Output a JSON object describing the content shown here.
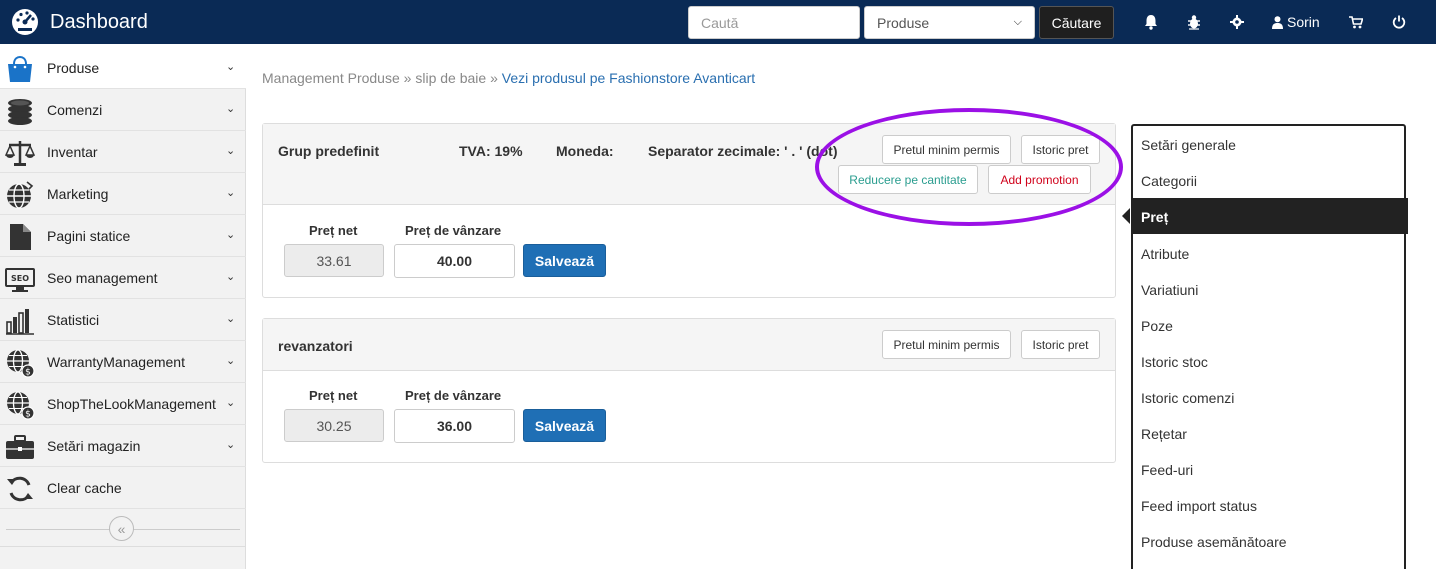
{
  "header": {
    "brand": "Dashboard",
    "search_placeholder": "Caută",
    "search_scope": "Produse",
    "search_button": "Căutare",
    "user_name": "Sorin"
  },
  "sidebar": {
    "items": [
      {
        "label": "Produse",
        "icon": "shopping-bag-icon"
      },
      {
        "label": "Comenzi",
        "icon": "coins-icon"
      },
      {
        "label": "Inventar",
        "icon": "scale-icon"
      },
      {
        "label": "Marketing",
        "icon": "globe-icon"
      },
      {
        "label": "Pagini statice",
        "icon": "file-icon"
      },
      {
        "label": "Seo management",
        "icon": "seo-monitor-icon"
      },
      {
        "label": "Statistici",
        "icon": "bar-chart-icon"
      },
      {
        "label": "WarrantyManagement",
        "icon": "globe-dollar-icon"
      },
      {
        "label": "ShopTheLookManagement",
        "icon": "globe-dollar-icon"
      },
      {
        "label": "Setări magazin",
        "icon": "briefcase-icon"
      },
      {
        "label": "Clear cache",
        "icon": "refresh-icon"
      }
    ]
  },
  "breadcrumb": {
    "part1": "Management Produse",
    "sep": "»",
    "part2": "slip de baie",
    "link": "Vezi produsul pe Fashionstore Avanticart"
  },
  "group1": {
    "title": "Grup predefinit",
    "tva": "TVA: 19%",
    "moneda": "Moneda:",
    "separator": "Separator zecimale: ' . ' (dot)",
    "btn_min_price": "Pretul minim permis",
    "btn_history": "Istoric pret",
    "btn_discount": "Reducere pe cantitate",
    "btn_promotion": "Add promotion",
    "label_net": "Preț net",
    "label_sale": "Preț de vânzare",
    "net": "33.61",
    "sale": "40.00",
    "save": "Salvează"
  },
  "group2": {
    "title": "revanzatori",
    "btn_min_price": "Pretul minim permis",
    "btn_history": "Istoric pret",
    "label_net": "Preț net",
    "label_sale": "Preț de vânzare",
    "net": "30.25",
    "sale": "36.00",
    "save": "Salvează"
  },
  "right_nav": {
    "items": [
      {
        "label": "Setări generale"
      },
      {
        "label": "Categorii"
      },
      {
        "label": "Preț"
      },
      {
        "label": "Atribute"
      },
      {
        "label": "Variatiuni"
      },
      {
        "label": "Poze"
      },
      {
        "label": "Istoric stoc"
      },
      {
        "label": "Istoric comenzi"
      },
      {
        "label": "Rețetar"
      },
      {
        "label": "Feed-uri"
      },
      {
        "label": "Feed import status"
      },
      {
        "label": "Produse asemănătoare"
      }
    ]
  },
  "colors": {
    "topbar": "#0a2a55",
    "primary_button": "#1f6fb5",
    "annotation": "#9b10e6",
    "promotion_text": "#d0021b",
    "discount_text": "#2a9d8f"
  }
}
